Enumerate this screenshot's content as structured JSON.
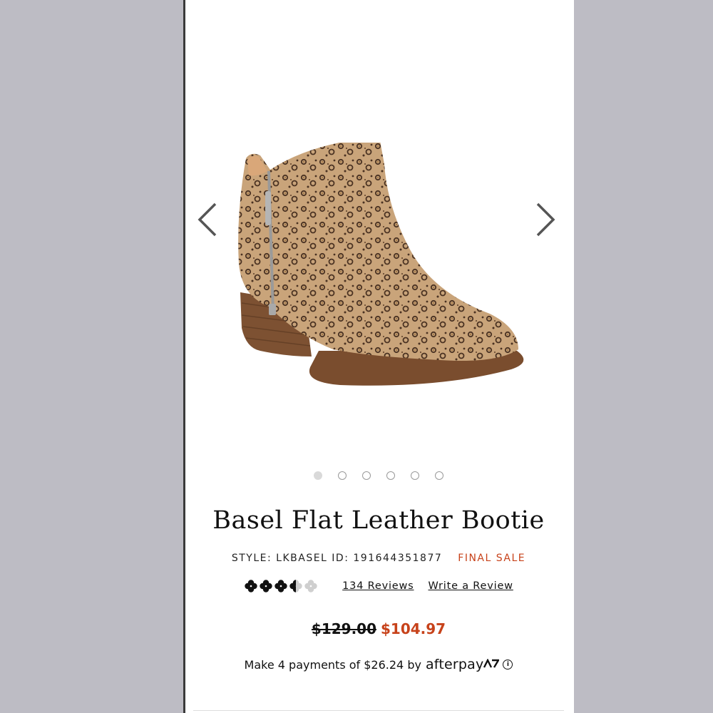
{
  "product": {
    "title": "Basel Flat Leather Bootie",
    "style_line": "STYLE: LKBASEL ID: 191644351877",
    "sale_tag": "FINAL SALE",
    "rating": 3.5,
    "rating_max": 5,
    "reviews_link": "134 Reviews",
    "write_review_link": "Write a Review",
    "original_price": "$129.00",
    "sale_price": "$104.97",
    "payment_text": "Make 4 payments of $26.24 by",
    "afterpay_brand": "afterpay",
    "info_glyph": "i"
  },
  "carousel": {
    "image_count": 6,
    "active_index": 0,
    "prev_icon": "chevron-left-icon",
    "next_icon": "chevron-right-icon"
  },
  "colors": {
    "sale": "#c7421a",
    "background": "#bdbcc4"
  }
}
